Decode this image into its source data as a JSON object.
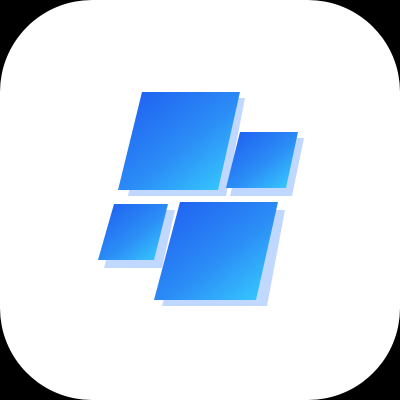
{
  "icon": {
    "semantic": "skewed-tiles-app-icon",
    "background_color": "#000000",
    "tile_background_color": "#FFFFFF",
    "gradient": {
      "top_color": "#1E5BF0",
      "mid_color": "#2B8DF6",
      "bottom_color": "#38D2FF"
    },
    "shadow_color": "#9FC4FF"
  }
}
